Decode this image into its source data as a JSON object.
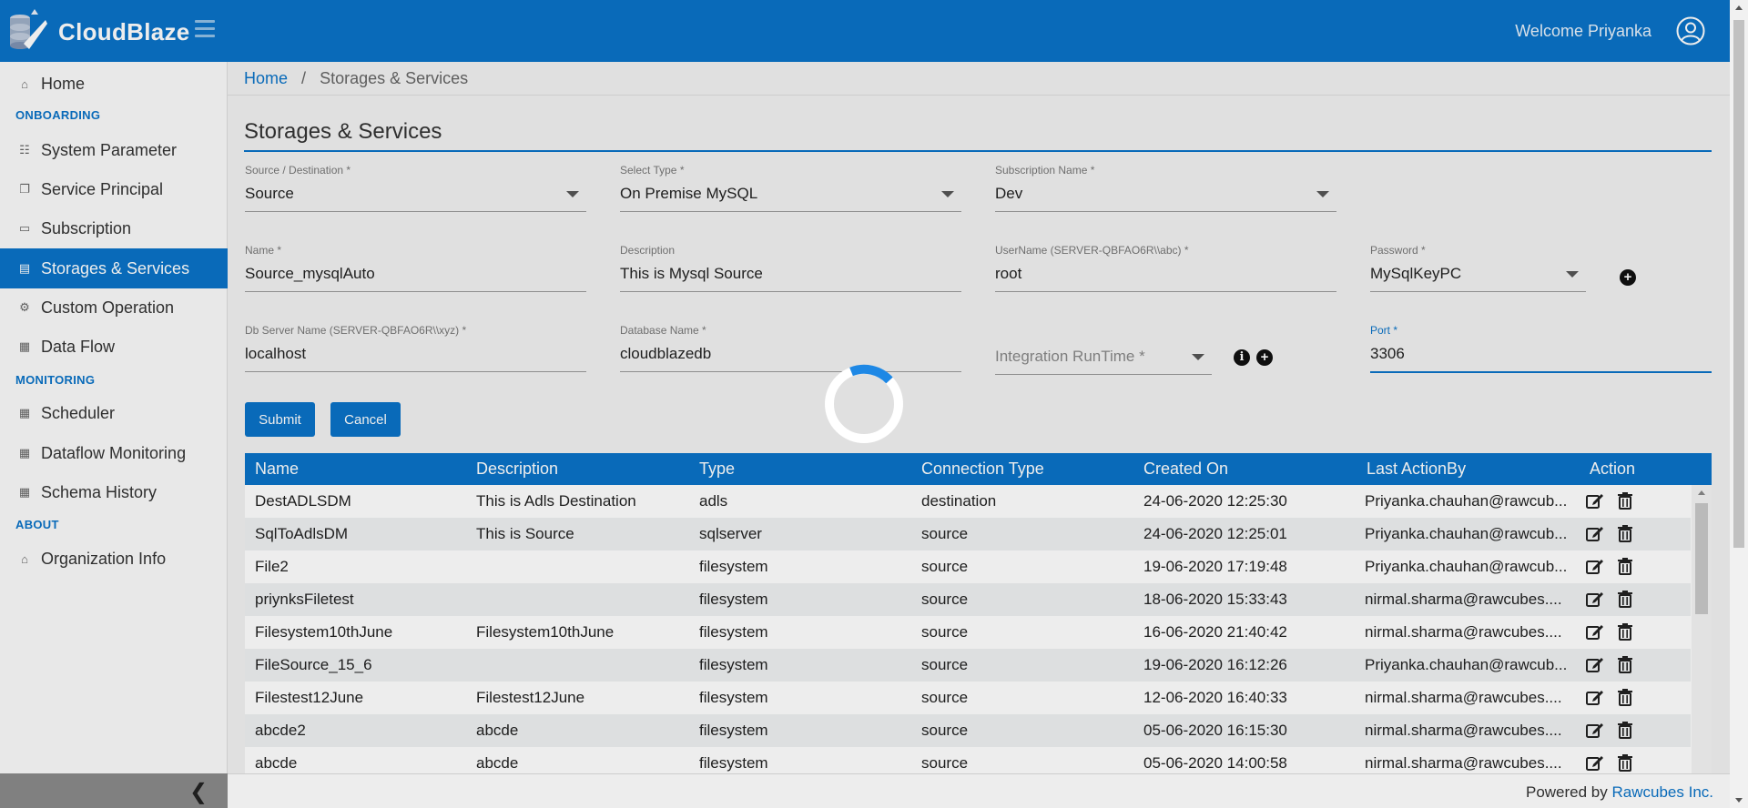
{
  "header": {
    "brand": "CloudBlaze",
    "welcome": "Welcome Priyanka",
    "colors": {
      "primary": "#0a73c7"
    }
  },
  "sidebar": {
    "items": [
      {
        "label": "Home",
        "icon": "home-icon"
      },
      {
        "label": "System Parameter",
        "icon": "sliders-icon"
      },
      {
        "label": "Service Principal",
        "icon": "copy-icon"
      },
      {
        "label": "Subscription",
        "icon": "card-icon"
      },
      {
        "label": "Storages & Services",
        "icon": "storage-icon"
      },
      {
        "label": "Custom Operation",
        "icon": "cogs-icon"
      },
      {
        "label": "Data Flow",
        "icon": "table-icon"
      },
      {
        "label": "Scheduler",
        "icon": "calendar-icon"
      },
      {
        "label": "Dataflow Monitoring",
        "icon": "calendar-icon"
      },
      {
        "label": "Schema History",
        "icon": "calendar-icon"
      },
      {
        "label": "Organization Info",
        "icon": "bank-icon"
      }
    ],
    "sections": {
      "onboarding": "ONBOARDING",
      "monitoring": "MONITORING",
      "about": "ABOUT"
    },
    "active": "Storages & Services"
  },
  "breadcrumb": {
    "home": "Home",
    "sep": "/",
    "current": "Storages & Services"
  },
  "page_title": "Storages & Services",
  "form": {
    "source_destination": {
      "label": "Source / Destination *",
      "value": "Source"
    },
    "select_type": {
      "label": "Select Type *",
      "value": "On Premise MySQL"
    },
    "subscription_name": {
      "label": "Subscription Name *",
      "value": "Dev"
    },
    "name": {
      "label": "Name *",
      "value": "Source_mysqlAuto"
    },
    "description": {
      "label": "Description",
      "value": "This is Mysql Source"
    },
    "username": {
      "label": "UserName (SERVER-QBFAO6R\\\\abc) *",
      "value": "root"
    },
    "password": {
      "label": "Password *",
      "value": "MySqlKeyPC"
    },
    "db_server": {
      "label": "Db Server Name (SERVER-QBFAO6R\\\\xyz) *",
      "value": "localhost"
    },
    "database_name": {
      "label": "Database Name *",
      "value": "cloudblazedb"
    },
    "integration_runtime": {
      "placeholder": "Integration RunTime *"
    },
    "port": {
      "label": "Port *",
      "value": "3306"
    },
    "submit": "Submit",
    "cancel": "Cancel"
  },
  "table": {
    "columns": [
      "Name",
      "Description",
      "Type",
      "Connection Type",
      "Created On",
      "Last ActionBy",
      "Action"
    ],
    "rows": [
      {
        "name": "DestADLSDM",
        "description": "This is Adls Destination",
        "type": "adls",
        "connection_type": "destination",
        "created_on": "24-06-2020 12:25:30",
        "last_action_by": "Priyanka.chauhan@rawcub..."
      },
      {
        "name": "SqlToAdlsDM",
        "description": "This is Source",
        "type": "sqlserver",
        "connection_type": "source",
        "created_on": "24-06-2020 12:25:01",
        "last_action_by": "Priyanka.chauhan@rawcub..."
      },
      {
        "name": "File2",
        "description": "",
        "type": "filesystem",
        "connection_type": "source",
        "created_on": "19-06-2020 17:19:48",
        "last_action_by": "Priyanka.chauhan@rawcub..."
      },
      {
        "name": "priynksFiletest",
        "description": "",
        "type": "filesystem",
        "connection_type": "source",
        "created_on": "18-06-2020 15:33:43",
        "last_action_by": "nirmal.sharma@rawcubes...."
      },
      {
        "name": "Filesystem10thJune",
        "description": "Filesystem10thJune",
        "type": "filesystem",
        "connection_type": "source",
        "created_on": "16-06-2020 21:40:42",
        "last_action_by": "nirmal.sharma@rawcubes...."
      },
      {
        "name": "FileSource_15_6",
        "description": "",
        "type": "filesystem",
        "connection_type": "source",
        "created_on": "19-06-2020 16:12:26",
        "last_action_by": "Priyanka.chauhan@rawcub..."
      },
      {
        "name": "Filestest12June",
        "description": "Filestest12June",
        "type": "filesystem",
        "connection_type": "source",
        "created_on": "12-06-2020 16:40:33",
        "last_action_by": "nirmal.sharma@rawcubes...."
      },
      {
        "name": "abcde2",
        "description": "abcde",
        "type": "filesystem",
        "connection_type": "source",
        "created_on": "05-06-2020 16:15:30",
        "last_action_by": "nirmal.sharma@rawcubes...."
      },
      {
        "name": "abcde",
        "description": "abcde",
        "type": "filesystem",
        "connection_type": "source",
        "created_on": "05-06-2020 14:00:58",
        "last_action_by": "nirmal.sharma@rawcubes...."
      }
    ]
  },
  "footer": {
    "powered_by": "Powered by",
    "company": "Rawcubes Inc."
  }
}
